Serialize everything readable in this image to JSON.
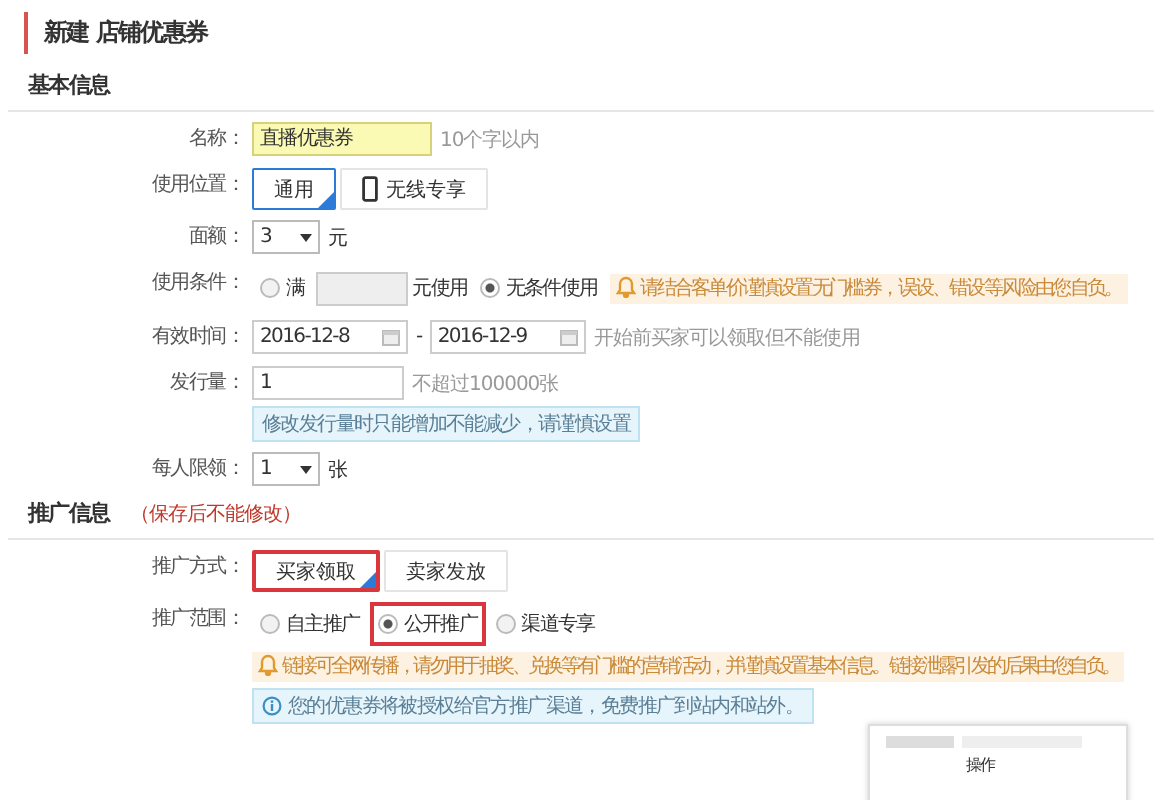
{
  "page_title": "新建 店铺优惠券",
  "sections": [
    {
      "title": "基本信息",
      "rows": [
        {
          "kind": "text",
          "label": "名称：",
          "value": "直播优惠券",
          "hint": "10个字以内",
          "highlighted": true
        },
        {
          "kind": "options",
          "label": "使用位置：",
          "options": [
            {
              "label": "通用",
              "kind": "plain",
              "selected": true,
              "marked": false
            },
            {
              "label": "无线专享",
              "kind": "mobile",
              "selected": false,
              "marked": false
            }
          ]
        },
        {
          "kind": "select",
          "label": "面额：",
          "value": "3",
          "unit": "元"
        },
        {
          "kind": "condition",
          "label": "使用条件：",
          "options": [
            {
              "label": "满",
              "selected": false
            },
            {
              "label": "无条件使用",
              "selected": true
            }
          ],
          "amount_unit": "元使用",
          "warning": "请结合客单价谨慎设置无门槛券，误设、错设等风险由您自负。"
        },
        {
          "kind": "dates",
          "label": "有效时间：",
          "start": "2016-12-8",
          "separator": "-",
          "end": "2016-12-9",
          "hint": "开始前买家可以领取但不能使用"
        },
        {
          "kind": "text",
          "label": "发行量：",
          "value": "1",
          "hint": "不超过100000张",
          "highlighted": false,
          "info": "修改发行量时只能增加不能减少，请谨慎设置"
        },
        {
          "kind": "select",
          "label": "每人限领：",
          "value": "1",
          "unit": "张"
        }
      ]
    },
    {
      "title": "推广信息",
      "note": "（保存后不能修改）",
      "rows": [
        {
          "kind": "options",
          "label": "推广方式：",
          "options": [
            {
              "label": "买家领取",
              "kind": "plain",
              "selected": true,
              "marked": true
            },
            {
              "label": "卖家发放",
              "kind": "plain",
              "selected": false,
              "marked": false
            }
          ]
        },
        {
          "kind": "radios",
          "label": "推广范围：",
          "options": [
            {
              "label": "自主推广",
              "selected": false,
              "marked": false
            },
            {
              "label": "公开推广",
              "selected": true,
              "marked": true
            },
            {
              "label": "渠道专享",
              "selected": false,
              "marked": false
            }
          ],
          "warning": "链接可全网传播，请勿用于抽奖、兑换等有门槛的营销活动，并谨慎设置基本信息。链接泄露引发的后果由您自负。",
          "info": "您的优惠券将被授权给官方推广渠道，免费推广到站内和站外。"
        }
      ]
    }
  ],
  "preview": {
    "menu_item": "操作"
  }
}
